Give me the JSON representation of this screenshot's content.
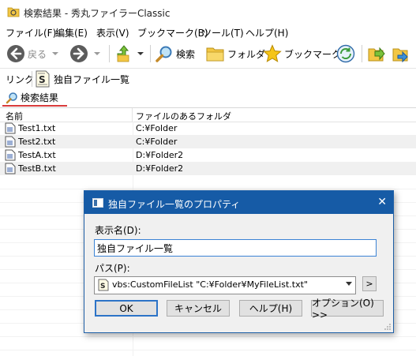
{
  "window": {
    "title": "検索結果 - 秀丸ファイラーClassic"
  },
  "menu": [
    "ファイル(F)",
    "編集(E)",
    "表示(V)",
    "ブックマーク(B)",
    "ツール(T)",
    "ヘルプ(H)"
  ],
  "toolbar": {
    "back_label": "戻る",
    "search_label": "検索",
    "folder_label": "フォルダ",
    "bookmark_label": "ブックマーク"
  },
  "linkbar": {
    "link_label": "リンク",
    "item_label": "独自ファイル一覧"
  },
  "tab": {
    "label": "検索結果"
  },
  "list": {
    "headers": [
      "名前",
      "ファイルのあるフォルダ"
    ],
    "rows": [
      {
        "name": "Test1.txt",
        "folder": "C:¥Folder"
      },
      {
        "name": "Test2.txt",
        "folder": "C:¥Folder"
      },
      {
        "name": "TestA.txt",
        "folder": "D:¥Folder2"
      },
      {
        "name": "TestB.txt",
        "folder": "D:¥Folder2"
      }
    ]
  },
  "dialog": {
    "title": "独自ファイル一覧のプロパティ",
    "close": "✕",
    "display_name_label": "表示名(D):",
    "display_name_value": "独自ファイル一覧",
    "path_label": "パス(P):",
    "path_value": "vbs:CustomFileList \"C:¥Folder¥MyFileList.txt\"",
    "browse_label": ">",
    "ok_label": "OK",
    "cancel_label": "キャンセル",
    "help_label": "ヘルプ(H)",
    "options_label": "オプション(O) >>"
  },
  "colors": {
    "accent": "#165ba6",
    "tab_underline": "#d83b3b",
    "row_alt": "#f0f0f0"
  }
}
